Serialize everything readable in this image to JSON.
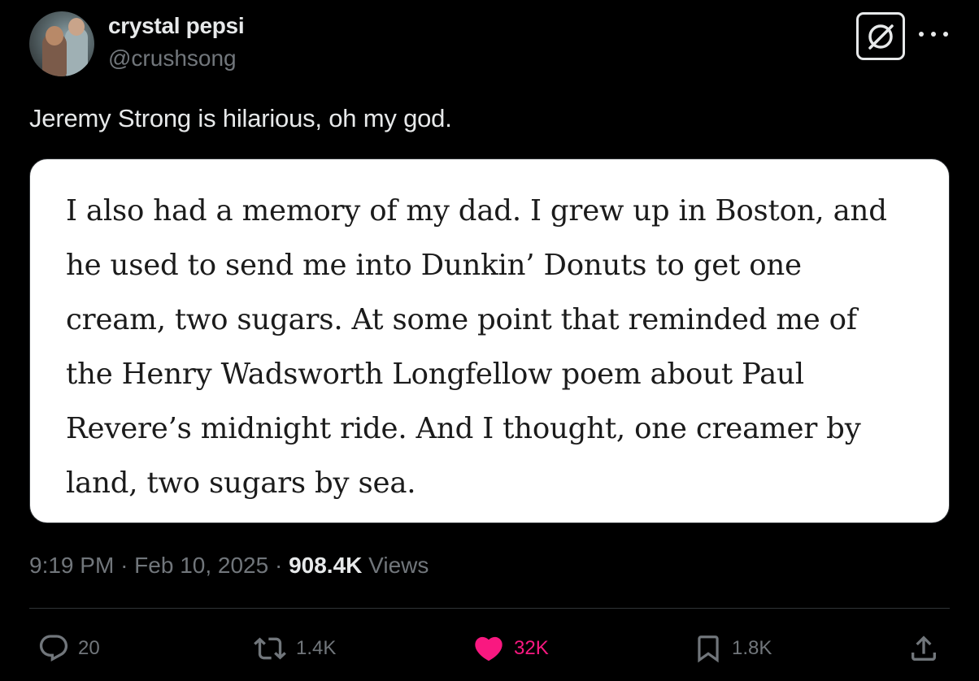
{
  "author": {
    "display_name": "crystal pepsi",
    "handle": "@crushsong"
  },
  "tweet": {
    "text": "Jeremy Strong is hilarious, oh my god.",
    "quote_image_lines": [
      "I also had a memory of my dad. I grew up in Boston, and",
      "he used to send me into Dunkin’ Donuts to get one",
      "cream, two sugars. At some point that reminded me of",
      "the Henry Wadsworth Longfellow poem about Paul",
      "Revere’s midnight ride. And I thought, one creamer by",
      "land, two sugars by sea."
    ]
  },
  "meta": {
    "time": "9:19 PM",
    "separator": "·",
    "date": "Feb 10, 2025",
    "views_count": "908.4K",
    "views_label": "Views"
  },
  "actions": {
    "replies": "20",
    "reposts": "1.4K",
    "likes": "32K",
    "bookmarks": "1.8K"
  },
  "icons": {
    "grok": "grok-icon",
    "more": "more-icon",
    "reply": "reply-icon",
    "repost": "repost-icon",
    "like": "heart-icon",
    "bookmark": "bookmark-icon",
    "share": "share-icon"
  },
  "colors": {
    "background": "#000000",
    "text_primary": "#e7e9ea",
    "text_secondary": "#71767b",
    "like_active": "#f91880",
    "divider": "#2f3336"
  }
}
